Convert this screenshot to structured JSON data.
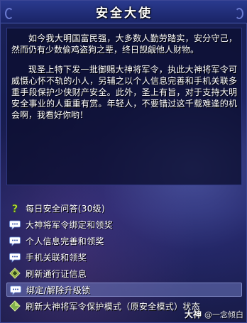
{
  "window": {
    "title": "安全大使"
  },
  "dialog": {
    "paragraphs": [
      "如今我大明国富民强，大多数人勤劳踏实，安分守己，然而仍有少数偷鸡盗狗之辈，终日觊觎他人财物。",
      "现圣上特下发一批御赐大神将军令，执此大神将军令可威慑心怀不轨的小人，另辅之以个人信息完善和手机关联多重手段保护少侠财产安全。此外，圣上有旨，对于支持大明安全事业的人重重有赏。年轻人，不要错过这千载难逢的机会啊，我看好你哟！"
    ]
  },
  "options": [
    {
      "label": "每日安全问答(30级)",
      "icon": "question-icon",
      "selected": false
    },
    {
      "label": "大神将军令绑定和领奖",
      "icon": "chat-bubble-icon",
      "selected": false
    },
    {
      "label": "个人信息完善和领奖",
      "icon": "chat-bubble-icon",
      "selected": false
    },
    {
      "label": "手机关联和领奖",
      "icon": "chat-bubble-icon",
      "selected": false
    },
    {
      "label": "刷新通行证信息",
      "icon": "diamond-gem-icon",
      "selected": false
    },
    {
      "label": "绑定/解除升级锁",
      "icon": "chat-bubble-icon",
      "selected": true
    },
    {
      "label": "刷新大神将军令保护模式（原安全模式）状态",
      "icon": "gem-icon",
      "selected": false
    }
  ],
  "watermark": {
    "brand": "大神",
    "user": "@一念倾白"
  },
  "colors": {
    "text": "#ffffff",
    "panel": "#161c4e",
    "selected": "#6e78be"
  }
}
